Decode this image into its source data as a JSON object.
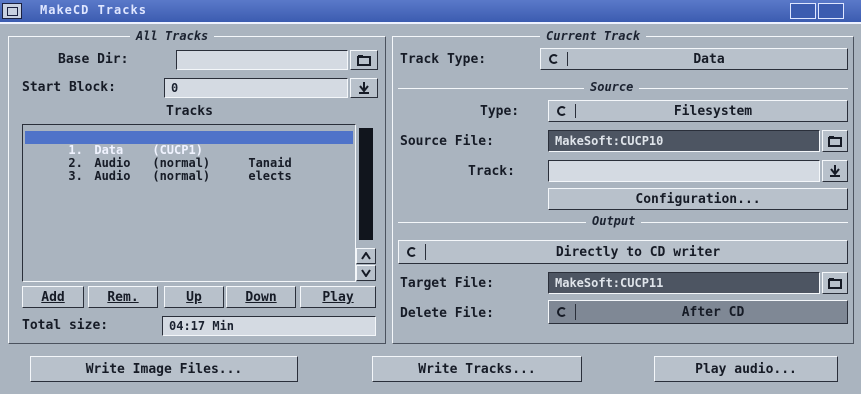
{
  "window": {
    "title": "MakeCD Tracks"
  },
  "all_tracks": {
    "frame_title": "All Tracks",
    "base_dir_label": "Base Dir:",
    "base_dir_value": "",
    "start_block_label": "Start Block:",
    "start_block_value": "0",
    "tracks_heading": "Tracks",
    "tracks": [
      {
        "num": "1.",
        "type": "Data",
        "mode": "(CUCP1)",
        "name": ""
      },
      {
        "num": "2.",
        "type": "Audio",
        "mode": "(normal)",
        "name": "Tanaid"
      },
      {
        "num": "3.",
        "type": "Audio",
        "mode": "(normal)",
        "name": "elects"
      }
    ],
    "buttons": {
      "add": "Add",
      "rem": "Rem.",
      "up": "Up",
      "down": "Down",
      "play": "Play"
    },
    "total_size_label": "Total size:",
    "total_size_value": "04:17 Min"
  },
  "current_track": {
    "frame_title": "Current Track",
    "track_type_label": "Track Type:",
    "track_type_value": "Data",
    "source": {
      "frame_title": "Source",
      "type_label": "Type:",
      "type_value": "Filesystem",
      "source_file_label": "Source File:",
      "source_file_value": "MakeSoft:CUCP10",
      "track_label": "Track:",
      "track_value": "",
      "configuration_label": "Configuration..."
    },
    "output": {
      "frame_title": "Output",
      "mode_value": "Directly to CD writer",
      "target_file_label": "Target File:",
      "target_file_value": "MakeSoft:CUCP11",
      "delete_file_label": "Delete File:",
      "delete_file_value": "After CD"
    }
  },
  "bottom_buttons": {
    "write_image": "Write Image Files...",
    "write_tracks": "Write Tracks...",
    "play_audio": "Play audio..."
  },
  "icons": {
    "file_requester": "folder-icon",
    "download": "down-arrow-icon",
    "cycle": "cycle-icon"
  }
}
